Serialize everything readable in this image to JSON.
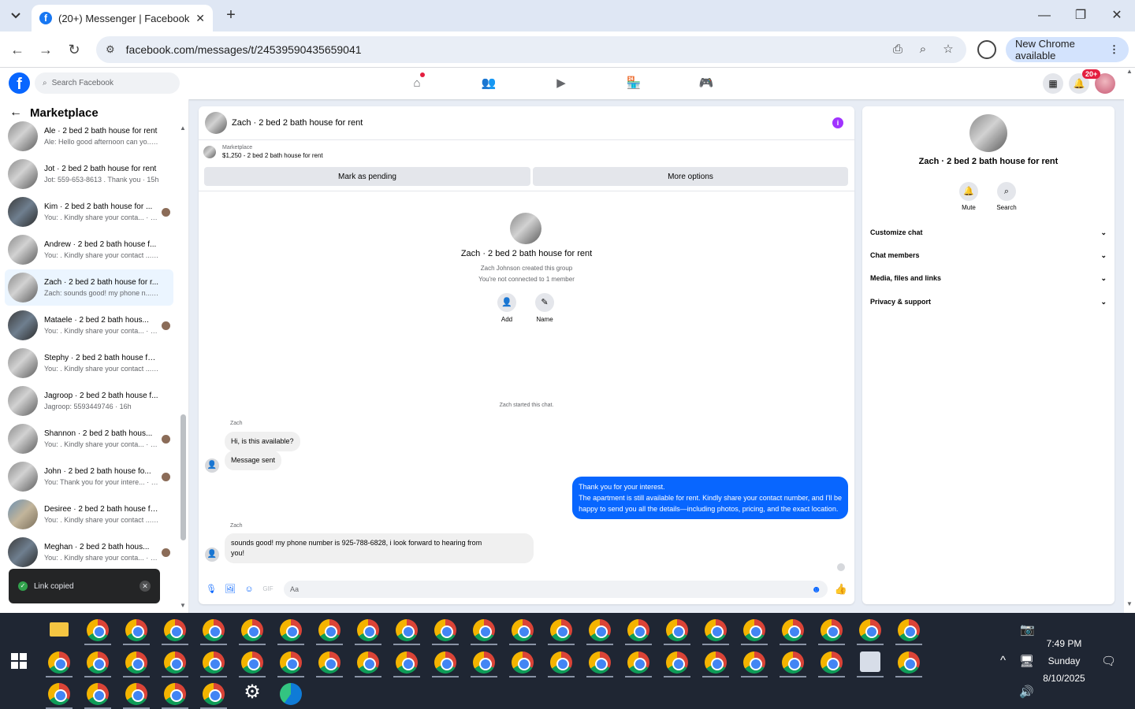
{
  "browser": {
    "tab_title": "(20+) Messenger | Facebook",
    "url": "facebook.com/messages/t/24539590435659041",
    "new_chrome_label": "New Chrome available"
  },
  "facebook": {
    "search_placeholder": "Search Facebook",
    "notification_badge": "20+"
  },
  "sidebar": {
    "title": "Marketplace",
    "conversations": [
      {
        "name": "Ale · 2 bed 2 bath house for rent",
        "preview": "Ale: Hello good afternoon can yo... · 15h",
        "avatar": "house1",
        "mini": false
      },
      {
        "name": "Jot · 2 bed 2 bath house for rent",
        "preview": "Jot: 559-653-8613 . Thank you · 15h",
        "avatar": "house1",
        "mini": false
      },
      {
        "name": "Kim · 2 bed 2 bath house for ...",
        "preview": "You: . Kindly share your conta... · 16h",
        "avatar": "house2",
        "mini": true
      },
      {
        "name": "Andrew · 2 bed 2 bath house f...",
        "preview": "You: . Kindly share your contact ... · 16h",
        "avatar": "house1",
        "mini": false
      },
      {
        "name": "Zach · 2 bed 2 bath house for r...",
        "preview": "Zach: sounds good! my phone n... · 16h",
        "avatar": "house1",
        "mini": false,
        "active": true
      },
      {
        "name": "Mataele · 2 bed 2 bath hous...",
        "preview": "You: . Kindly share your conta... · 16h",
        "avatar": "house2",
        "mini": true
      },
      {
        "name": "Stephy · 2 bed 2 bath house for...",
        "preview": "You: . Kindly share your contact ... · 16h",
        "avatar": "house1",
        "mini": false
      },
      {
        "name": "Jagroop · 2 bed 2 bath house f...",
        "preview": "Jagroop: 5593449746 · 16h",
        "avatar": "house1",
        "mini": false
      },
      {
        "name": "Shannon · 2 bed 2 bath hous...",
        "preview": "You: . Kindly share your conta... · 16h",
        "avatar": "house1",
        "mini": true
      },
      {
        "name": "John · 2 bed 2 bath house fo...",
        "preview": "You: Thank you for your intere... · 16h",
        "avatar": "house1",
        "mini": true
      },
      {
        "name": "Desiree · 2 bed 2 bath house fo...",
        "preview": "You: . Kindly share your contact ... · 16h",
        "avatar": "house3",
        "mini": false
      },
      {
        "name": "Meghan · 2 bed 2 bath hous...",
        "preview": "You: . Kindly share your conta... · 16h",
        "avatar": "house2",
        "mini": true
      }
    ]
  },
  "toast": {
    "text": "Link copied"
  },
  "chat": {
    "header_title": "Zach · 2 bed 2 bath house for rent",
    "marketplace_label": "Marketplace",
    "listing": "$1,250 - 2 bed 2 bath house for rent",
    "mark_pending": "Mark as pending",
    "more_options": "More options",
    "group_title": "Zach · 2 bed 2 bath house for rent",
    "created_by": "Zach Johnson created this group",
    "not_connected": "You're not connected to 1 member",
    "add_label": "Add",
    "name_label": "Name",
    "started": "Zach started this chat.",
    "sender1": "Zach",
    "msg1": "Hi, is this available?",
    "msg2": "Message sent",
    "out_line1": "Thank you for your interest.",
    "out_line2": "The apartment is still available for rent. Kindly share your contact number, and I'll be",
    "out_line3": "happy to send you all the details—including photos, pricing, and the exact location.",
    "sender2": "Zach",
    "msg3_line1": "sounds good! my phone number is 925-788-6828, i look forward to hearing from",
    "msg3_line2": "you!",
    "composer_placeholder": "Aa"
  },
  "right_panel": {
    "name": "Zach · 2 bed 2 bath house for rent",
    "mute": "Mute",
    "search": "Search",
    "sections": [
      "Customize chat",
      "Chat members",
      "Media, files and links",
      "Privacy & support"
    ]
  },
  "taskbar": {
    "time": "7:49 PM",
    "day": "Sunday",
    "date": "8/10/2025"
  }
}
